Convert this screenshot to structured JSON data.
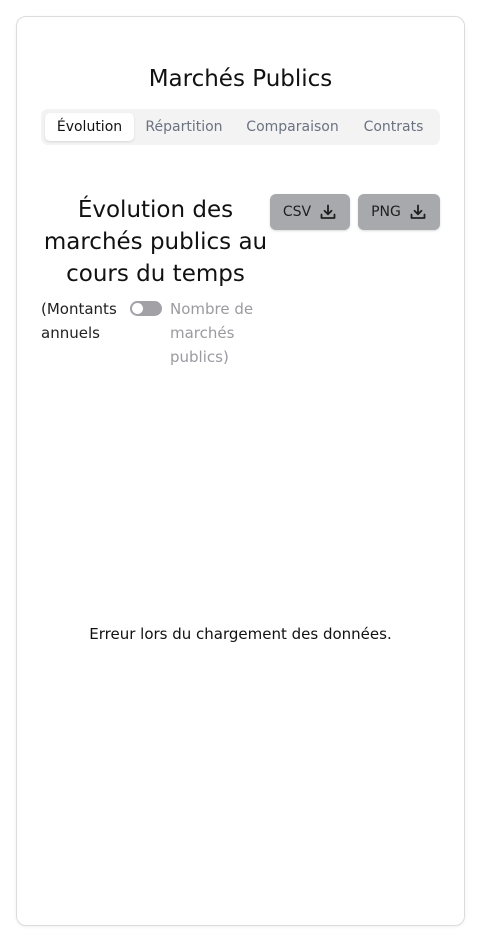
{
  "page": {
    "title": "Marchés Publics"
  },
  "tabs": [
    {
      "label": "Évolution",
      "active": true
    },
    {
      "label": "Répartition",
      "active": false
    },
    {
      "label": "Comparaison",
      "active": false
    },
    {
      "label": "Contrats",
      "active": false
    }
  ],
  "panel": {
    "title": "Évolution des marchés publics au cours du temps",
    "buttons": {
      "csv_label": "CSV",
      "csv_icon": "download-icon",
      "png_label": "PNG",
      "png_icon": "download-icon"
    },
    "toggle": {
      "left_label": "(Montants annuels",
      "right_label": "Nombre de marchés publics)",
      "checked": false
    },
    "error_message": "Erreur lors du chargement des données."
  },
  "colors": {
    "button_bg": "#a8a9ad",
    "tab_bar_bg": "#f3f3f4",
    "muted_text": "#9a9aa0",
    "toggle_track": "#a1a1a6"
  }
}
